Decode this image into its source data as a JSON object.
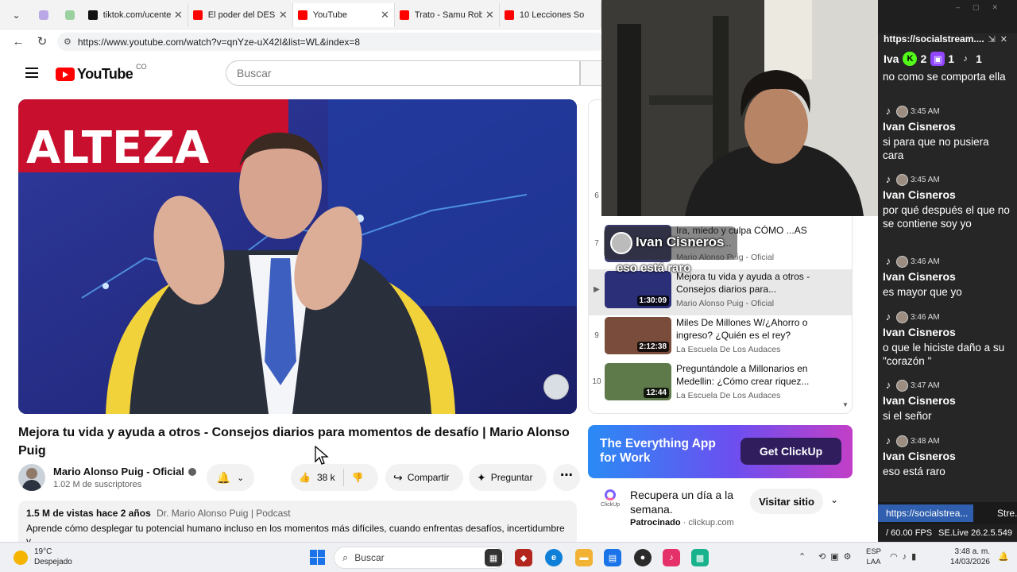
{
  "browser": {
    "tabs": [
      {
        "title": "tiktok.com/ucenter",
        "color": "#111111"
      },
      {
        "title": "El poder del DESPE",
        "color": "#ff0000"
      },
      {
        "title": "YouTube",
        "color": "#ff0000"
      },
      {
        "title": "Trato - Samu Roble",
        "color": "#ff0000"
      },
      {
        "title": "10 Lecciones So",
        "color": "#ff0000"
      }
    ],
    "url": "https://www.youtube.com/watch?v=qnYze-uX42I&list=WL&index=8"
  },
  "youtube": {
    "logo_text": "YouTube",
    "country_code": "CO",
    "search_placeholder": "Buscar",
    "video_title": "Mejora tu vida y ayuda a otros - Consejos diarios para momentos de desafío | Mario Alonso Puig",
    "channel_name": "Mario Alonso Puig - Oficial",
    "subscribers": "1.02 M de suscriptores",
    "likes": "38 k",
    "share_label": "Compartir",
    "ask_label": "Preguntar",
    "views_date": "1.5 M de vistas  hace 2 años",
    "podcast_tag": "Dr. Mario Alonso Puig | Podcast",
    "description": "Aprende cómo desplegar tu potencial humano incluso en los momentos más difíciles, cuando enfrentas desafíos, incertidumbre y",
    "video_banner_text": "ALTEZA"
  },
  "playlist": {
    "partial_index": "6",
    "items": [
      {
        "index": "7",
        "title": "Ira, miedo y culpa CÓMO ...AS GRANDES...",
        "channel": "Mario Alonso Puig - Oficial",
        "duration": "",
        "active": false,
        "thumb": "#3c3c6c"
      },
      {
        "index": "▶",
        "title": "Mejora tu vida y ayuda a otros - Consejos diarios para...",
        "channel": "Mario Alonso Puig - Oficial",
        "duration": "1:30:09",
        "active": true,
        "thumb": "#2b2f78"
      },
      {
        "index": "9",
        "title": "Miles De Millones W/¿Ahorro o ingreso? ¿Quién es el rey?",
        "channel": "La Escuela De Los Audaces",
        "duration": "2:12:38",
        "active": false,
        "thumb": "#7a4c3c"
      },
      {
        "index": "10",
        "title": "Preguntándole a Millonarios en Medellin: ¿Cómo crear riquez...",
        "channel": "La Escuela De Los Audaces",
        "duration": "12:44",
        "active": false,
        "thumb": "#5e7a4a"
      }
    ]
  },
  "ad": {
    "headline": "The Everything App for Work",
    "cta": "Get ClickUp",
    "text": "Recupera un día a la semana.",
    "sponsored": "Patrocinado",
    "domain": "clickup.com",
    "visit": "Visitar sitio",
    "logo_label": "ClickUp"
  },
  "overlay": {
    "name": "Ivan Cisneros",
    "message": "eso está raro"
  },
  "chat": {
    "url": "https://socialstream....",
    "viewer_name": "Iva",
    "counts": [
      {
        "value": "2",
        "color": "#53fc18",
        "glyph": "K"
      },
      {
        "value": "1",
        "color": "#9146ff",
        "glyph": "▣"
      },
      {
        "value": "1",
        "color": "#222222",
        "glyph": "♪"
      }
    ],
    "messages": [
      {
        "time": "",
        "user": "",
        "text": "no como se comporta ella"
      },
      {
        "time": "3:45 AM",
        "user": "Ivan Cisneros",
        "text": "si para que no pusiera cara"
      },
      {
        "time": "3:45 AM",
        "user": "Ivan Cisneros",
        "text": "por qué después el que no se contiene soy yo"
      },
      {
        "time": "3:46 AM",
        "user": "Ivan Cisneros",
        "text": "es mayor que yo"
      },
      {
        "time": "3:46 AM",
        "user": "Ivan Cisneros",
        "text": "o que le hiciste daño a su \"corazón \""
      },
      {
        "time": "3:47 AM",
        "user": "Ivan Cisneros",
        "text": "si el señor"
      },
      {
        "time": "3:48 AM",
        "user": "Ivan Cisneros",
        "text": "eso está raro"
      }
    ],
    "footer_tab1": "https://socialstrea...",
    "footer_tab2": "Stre...",
    "fps": "/ 60.00 FPS",
    "version": "SE.Live 26.2.5.549"
  },
  "taskbar": {
    "temp": "19°C",
    "condition": "Despejado",
    "search": "Buscar",
    "lang1": "ESP",
    "lang2": "LAA",
    "time": "3:48 a. m.",
    "date": "14/03/2026"
  }
}
